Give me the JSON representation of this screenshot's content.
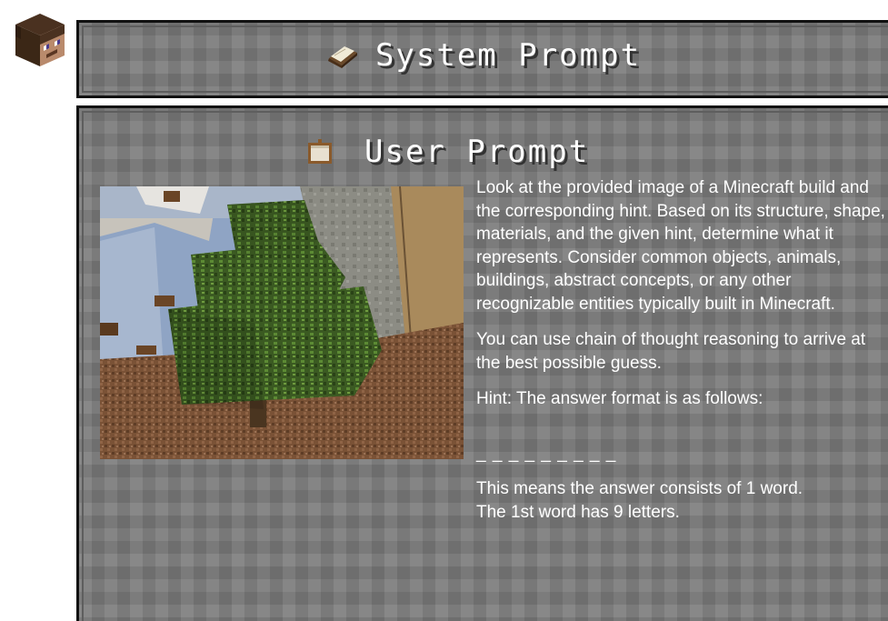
{
  "system_prompt": {
    "title": "System Prompt",
    "icon": "book-icon"
  },
  "user_prompt": {
    "title": "User Prompt",
    "icon": "item-frame-icon",
    "image": {
      "icon": "minecraft-tree-build-image"
    },
    "paragraphs": {
      "intro": "Look at the provided image of a Minecraft build and the corresponding hint. Based on its structure, shape, materials, and the given hint, determine what it represents. Consider common objects, animals, buildings, abstract concepts, or any other recognizable entities typically built in Minecraft.",
      "reasoning": "You can use chain of thought reasoning to arrive at the best possible guess.",
      "hint": "Hint:  The answer format is as follows:",
      "blanks": "_ _ _ _ _ _ _ _ _",
      "explanation_1": "This means the answer consists of 1 word.",
      "explanation_2": "The 1st word has 9 letters."
    }
  },
  "avatar": {
    "icon": "steve-head-icon"
  }
}
